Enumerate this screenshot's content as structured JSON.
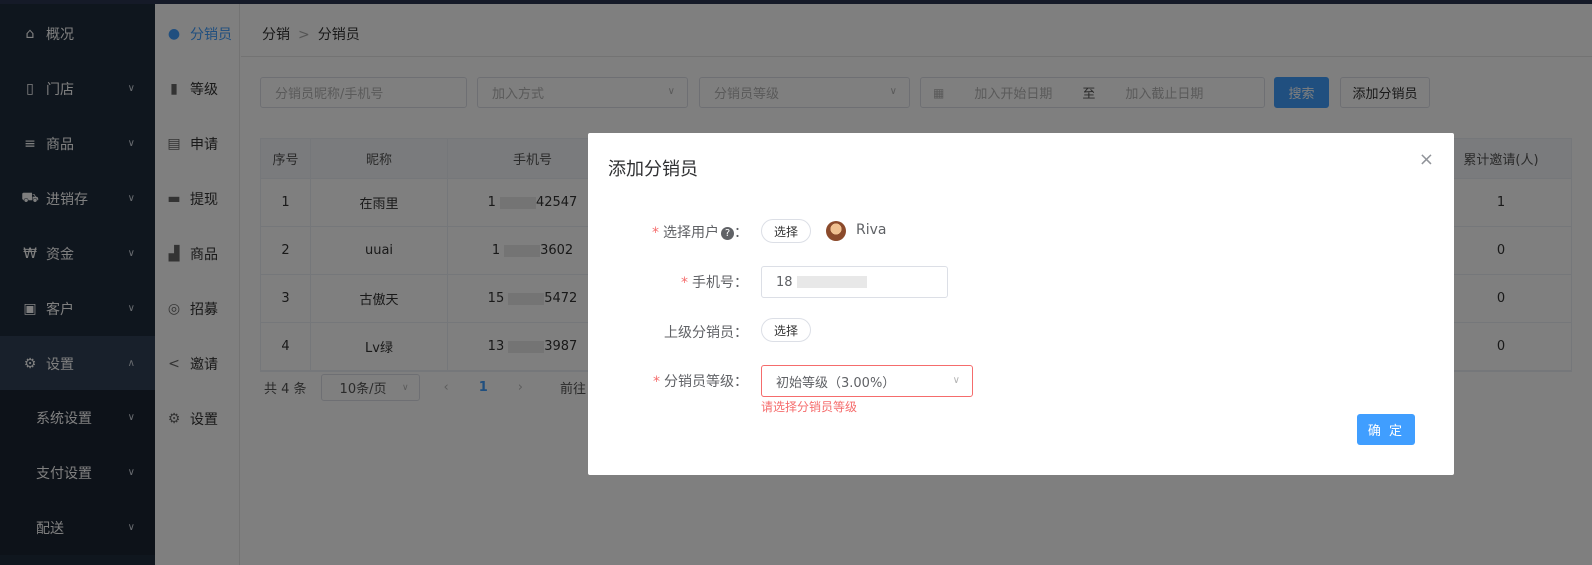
{
  "sidebar": {
    "items": [
      {
        "label": "概况",
        "icon": "home-icon"
      },
      {
        "label": "门店",
        "icon": "store-icon"
      },
      {
        "label": "商品",
        "icon": "list-icon"
      },
      {
        "label": "进销存",
        "icon": "truck-icon"
      },
      {
        "label": "资金",
        "icon": "won-icon"
      },
      {
        "label": "客户",
        "icon": "id-card-icon"
      },
      {
        "label": "设置",
        "icon": "gear-icon"
      }
    ],
    "subitems": [
      {
        "label": "系统设置"
      },
      {
        "label": "支付设置"
      },
      {
        "label": "配送"
      }
    ]
  },
  "submenu": {
    "items": [
      {
        "label": "分销员",
        "icon": "user-icon"
      },
      {
        "label": "等级",
        "icon": "bar-chart-icon"
      },
      {
        "label": "申请",
        "icon": "clipboard-icon"
      },
      {
        "label": "提现",
        "icon": "wallet-icon"
      },
      {
        "label": "商品",
        "icon": "bag-icon"
      },
      {
        "label": "招募",
        "icon": "recruit-icon"
      },
      {
        "label": "邀请",
        "icon": "share-icon"
      },
      {
        "label": "设置",
        "icon": "gear-icon"
      }
    ]
  },
  "breadcrumb": {
    "root": "分销",
    "current": "分销员"
  },
  "filters": {
    "search_placeholder": "分销员昵称/手机号",
    "join_method_placeholder": "加入方式",
    "level_placeholder": "分销员等级",
    "start_date_placeholder": "加入开始日期",
    "range_sep": "至",
    "end_date_placeholder": "加入截止日期",
    "search_button": "搜索",
    "add_button": "添加分销员"
  },
  "table": {
    "headers": {
      "index": "序号",
      "nickname": "昵称",
      "phone": "手机号",
      "invited": "累计邀请(人)"
    },
    "rows": [
      {
        "index": "1",
        "nickname": "在雨里",
        "phone_prefix": "1",
        "phone_suffix": "42547",
        "invited": "1"
      },
      {
        "index": "2",
        "nickname": "uuai",
        "phone_prefix": "1",
        "phone_suffix": "3602",
        "invited": "0"
      },
      {
        "index": "3",
        "nickname": "古傲天",
        "phone_prefix": "15",
        "phone_suffix": "5472",
        "invited": "0"
      },
      {
        "index": "4",
        "nickname": "Lv绿",
        "phone_prefix": "13",
        "phone_suffix": "3987",
        "invited": "0"
      }
    ]
  },
  "pager": {
    "total": "共 4 条",
    "page_size": "10条/页",
    "prev": "‹",
    "page": "1",
    "next": "›",
    "goto": "前往"
  },
  "dialog": {
    "title": "添加分销员",
    "close": "×",
    "select_user_label": "选择用户",
    "help_glyph": "?",
    "colon": "：",
    "select_button": "选择",
    "user_name": "Riva",
    "phone_label": "手机号",
    "phone_value": "18",
    "parent_label": "上级分销员",
    "parent_button": "选择",
    "level_label": "分销员等级",
    "level_value": "初始等级（3.00%）",
    "level_error": "请选择分销员等级",
    "confirm": "确 定"
  },
  "colors": {
    "primary": "#409eff",
    "error": "#f56c6c",
    "sidebar": "#1f2d3d"
  }
}
